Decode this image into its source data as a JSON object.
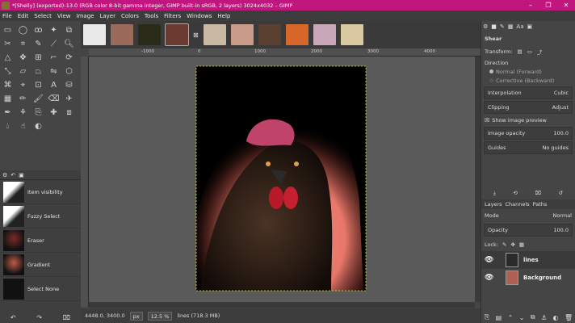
{
  "window": {
    "title": "*[Shelly] (exported)-13.0 (RGB color 8-bit gamma integer, GIMP built-in sRGB, 2 layers) 3024x4032 – GIMP",
    "minimize": "–",
    "maximize": "❐",
    "close": "✕"
  },
  "menu": [
    "File",
    "Edit",
    "Select",
    "View",
    "Image",
    "Layer",
    "Colors",
    "Tools",
    "Filters",
    "Windows",
    "Help"
  ],
  "image_tabs": [
    {
      "name": "thumb-1",
      "color": "#e9e9e9"
    },
    {
      "name": "thumb-2",
      "color": "#9a6a5a"
    },
    {
      "name": "thumb-3",
      "color": "#2b2b1a"
    },
    {
      "name": "thumb-4",
      "color": "#6a3a30"
    },
    {
      "name": "thumb-5",
      "color": "#c9b8a2"
    },
    {
      "name": "thumb-6",
      "color": "#c89a88"
    },
    {
      "name": "thumb-7",
      "color": "#5a4030"
    },
    {
      "name": "thumb-8",
      "color": "#d8662a"
    },
    {
      "name": "thumb-9",
      "color": "#c8a8b8"
    },
    {
      "name": "thumb-10",
      "color": "#d9c8a0"
    }
  ],
  "ruler": {
    "ticks": [
      "-1000",
      "0",
      "1000",
      "2000",
      "3000",
      "4000"
    ]
  },
  "tool_options": {
    "title": "Shear",
    "transform_label": "Transform:",
    "direction_label": "Direction",
    "direction_normal": "Normal (Forward)",
    "direction_corrective": "Corrective (Backward)",
    "interpolation_label": "Interpolation",
    "interpolation_value": "Cubic",
    "clipping_label": "Clipping",
    "clipping_value": "Adjust",
    "show_preview": "Show image preview",
    "image_opacity_label": "Image opacity",
    "image_opacity_value": "100.0",
    "guides_label": "Guides",
    "guides_value": "No guides"
  },
  "layers_panel": {
    "tabs": [
      "Layers",
      "Channels",
      "Paths"
    ],
    "mode_label": "Mode",
    "mode_value": "Normal",
    "opacity_label": "Opacity",
    "opacity_value": "100.0",
    "lock_label": "Lock:",
    "layers": [
      {
        "name": "lines"
      },
      {
        "name": "Background"
      }
    ]
  },
  "history": {
    "items": [
      "Item visibility",
      "Fuzzy Select",
      "Eraser",
      "Gradient",
      "Select None"
    ]
  },
  "status": {
    "coords": "4448.0, 3400.0",
    "unit": "px",
    "zoom": "12.5 %",
    "info": "lines (718.3 MB)"
  },
  "colors": {
    "foreground": "#c65a5a",
    "background": "#ffffff",
    "titlebar": "#c0167e"
  }
}
